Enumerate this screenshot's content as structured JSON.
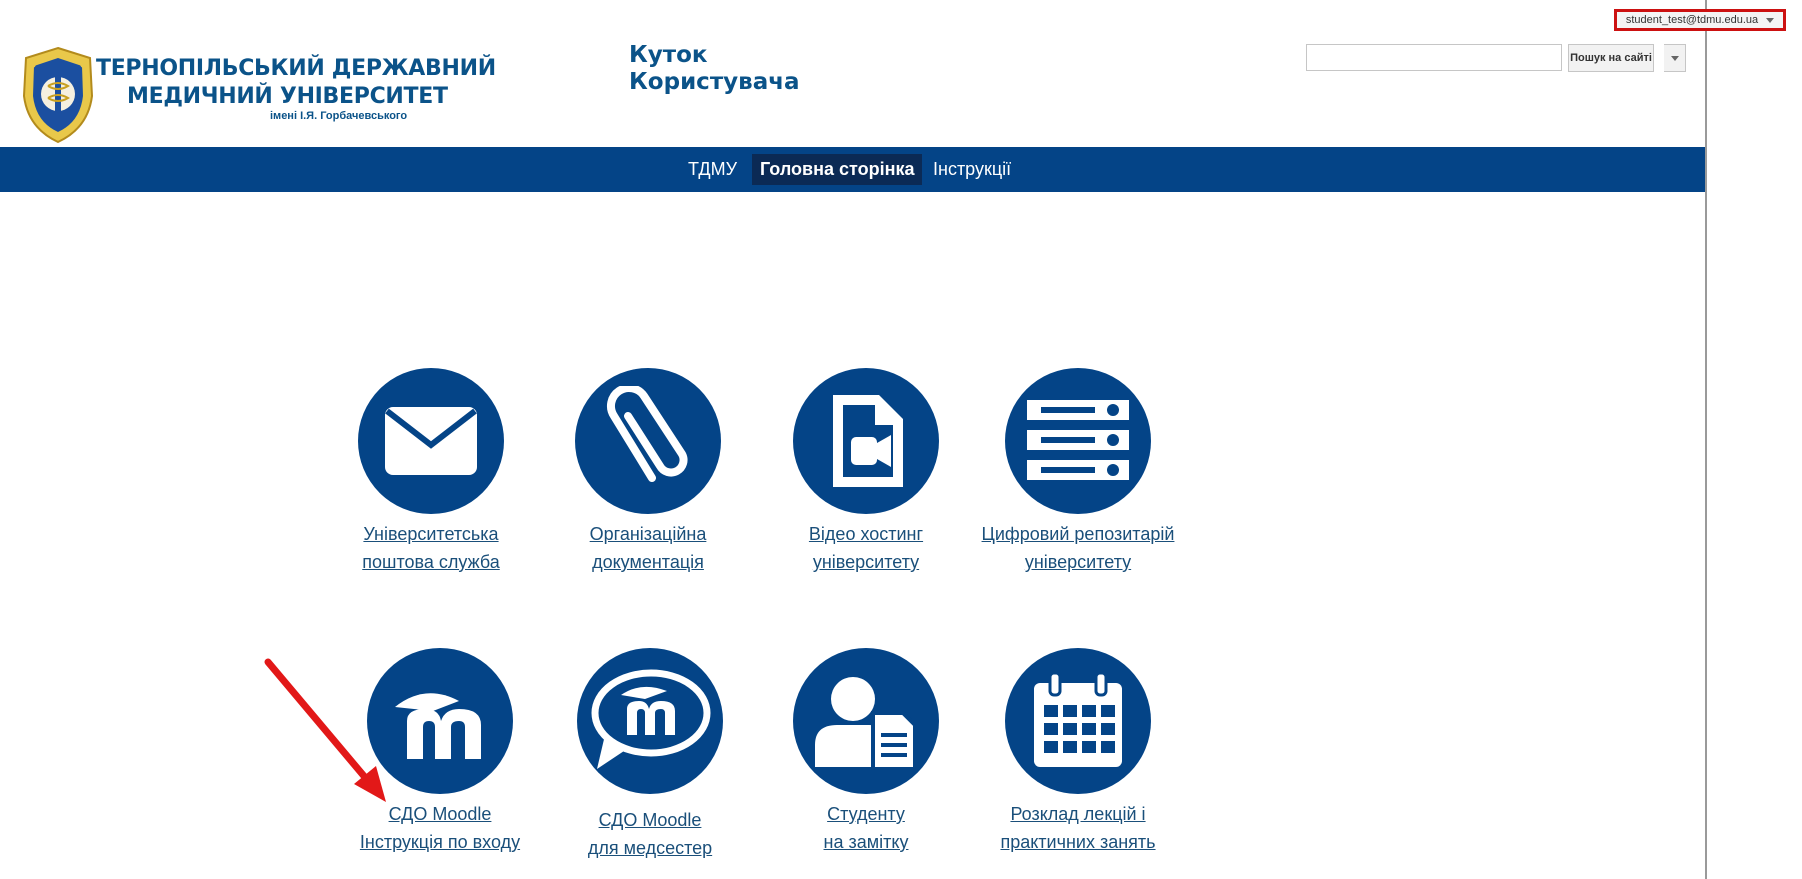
{
  "account": {
    "email": "student_test@tdmu.edu.ua"
  },
  "header": {
    "university_line1": "ТЕРНОПІЛЬСЬКИЙ ДЕРЖАВНИЙ",
    "university_line2": "МЕДИЧНИЙ УНІВЕРСИТЕТ",
    "university_line3": "імені І.Я. Горбачевського",
    "title_line1": "Куток",
    "title_line2": "Користувача"
  },
  "search": {
    "placeholder": "",
    "value": "",
    "button_label": "Пошук на сайті"
  },
  "nav": {
    "items": [
      {
        "label": "ТДМУ",
        "active": false
      },
      {
        "label": "Головна сторінка",
        "active": true
      },
      {
        "label": "Інструкції",
        "active": false
      }
    ]
  },
  "tiles": [
    {
      "icon": "mail-icon",
      "line1": "Університетська",
      "line2": "поштова служба"
    },
    {
      "icon": "paperclip-icon",
      "line1": "Організаційна",
      "line2": "документація"
    },
    {
      "icon": "video-file-icon",
      "line1": "Відео хостинг",
      "line2": "університету"
    },
    {
      "icon": "server-icon",
      "line1": "Цифровий репозитарій",
      "line2": "університету"
    },
    {
      "icon": "moodle-icon",
      "line1": "СДО Moodle",
      "line2": "Інструкція по входу"
    },
    {
      "icon": "moodle-chat-icon",
      "line1": "СДО Moodle",
      "line2": "для медсестер"
    },
    {
      "icon": "student-document-icon",
      "line1": "Студенту",
      "line2": "на замітку"
    },
    {
      "icon": "calendar-icon",
      "line1": "Розклад лекцій і",
      "line2": "практичних занять"
    }
  ],
  "colors": {
    "brand": "#044487",
    "nav_active": "#0b2a55",
    "highlight": "#cc1111"
  }
}
